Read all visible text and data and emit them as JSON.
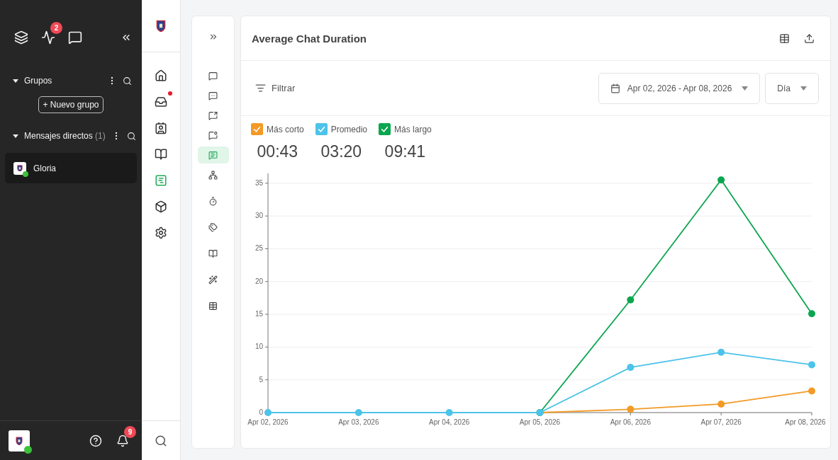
{
  "sidebar": {
    "activity_badge": "2",
    "groups": {
      "title": "Grupos",
      "expanded": true,
      "new_button": "+ Nuevo grupo"
    },
    "direct_messages": {
      "title": "Mensajes directos",
      "count": "(1)",
      "expanded": true,
      "items": [
        {
          "name": "Gloria",
          "online": true,
          "selected": true
        }
      ]
    },
    "footer": {
      "online": true,
      "notification_badge": "9"
    }
  },
  "rail": {
    "items": [
      {
        "kind": "home",
        "selected": false
      },
      {
        "kind": "inbox",
        "selected": false,
        "alert": true
      },
      {
        "kind": "contacts",
        "selected": false
      },
      {
        "kind": "book",
        "selected": false
      },
      {
        "kind": "reports",
        "selected": true
      },
      {
        "kind": "box",
        "selected": false
      },
      {
        "kind": "settings",
        "selected": false
      }
    ]
  },
  "subrail": {
    "items": [
      {
        "kind": "chat",
        "selected": false
      },
      {
        "kind": "chat-more",
        "selected": false
      },
      {
        "kind": "chat-share",
        "selected": false
      },
      {
        "kind": "chat-dot",
        "selected": false
      },
      {
        "kind": "chat-clock",
        "selected": true
      },
      {
        "kind": "network",
        "selected": false
      },
      {
        "kind": "timer",
        "selected": false
      },
      {
        "kind": "tags",
        "selected": false
      },
      {
        "kind": "book",
        "selected": false
      },
      {
        "kind": "wand",
        "selected": false
      },
      {
        "kind": "table",
        "selected": false
      }
    ]
  },
  "report": {
    "title": "Average Chat Duration",
    "filter": "Filtrar",
    "date_range": "Apr 02, 2026 - Apr 08, 2026",
    "period": "Día",
    "legend": [
      {
        "value": "00:43",
        "checked": true
      },
      {
        "value": "03:20",
        "checked": true
      },
      {
        "value": "09:41",
        "checked": true
      }
    ],
    "chart_data": {
      "type": "line",
      "categories": [
        "Apr 02, 2026",
        "Apr 03, 2026",
        "Apr 04, 2026",
        "Apr 05, 2026",
        "Apr 06, 2026",
        "Apr 07, 2026",
        "Apr 08, 2026"
      ],
      "ylim": [
        0,
        36.5
      ],
      "yticks": [
        0,
        5,
        10,
        15,
        20,
        25,
        30,
        35
      ],
      "grid": true,
      "series": [
        {
          "name": "Más corto",
          "color": "#f39a26",
          "marker": "circle",
          "values": [
            null,
            null,
            null,
            0,
            0.5,
            1.3,
            3.3
          ]
        },
        {
          "name": "Promedio",
          "color": "#4cc3ea",
          "marker": "circle",
          "values": [
            0,
            0,
            0,
            0,
            6.9,
            9.2,
            7.3
          ]
        },
        {
          "name": "Más largo",
          "color": "#0aa64f",
          "marker": "circle",
          "values": [
            null,
            null,
            null,
            0,
            17.2,
            35.5,
            15.1
          ]
        }
      ]
    }
  }
}
